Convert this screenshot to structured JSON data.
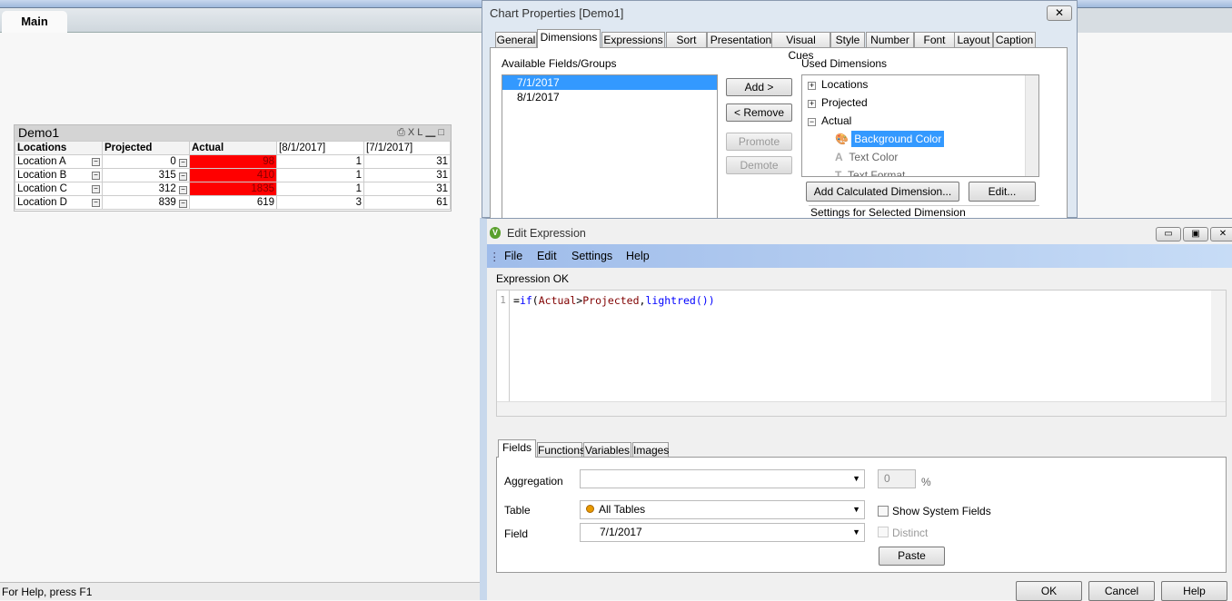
{
  "sheet": {
    "tab": "Main",
    "status": "For Help, press F1"
  },
  "table_object": {
    "title": "Demo1",
    "icons": [
      "print-icon",
      "xl-icon",
      "minimize-icon",
      "maximize-icon"
    ],
    "xl_label": "XL",
    "headers": [
      "Locations",
      "Projected",
      "Actual",
      "[8/1/2017]",
      "[7/1/2017]"
    ],
    "rows": [
      {
        "location": "Location A",
        "projected": "0",
        "actual": "98",
        "aug": "1",
        "jul": "31",
        "highlight": true
      },
      {
        "location": "Location B",
        "projected": "315",
        "actual": "410",
        "aug": "1",
        "jul": "31",
        "highlight": true
      },
      {
        "location": "Location C",
        "projected": "312",
        "actual": "1835",
        "aug": "1",
        "jul": "31",
        "highlight": true
      },
      {
        "location": "Location D",
        "projected": "839",
        "actual": "619",
        "aug": "3",
        "jul": "61",
        "highlight": false
      }
    ],
    "highlight_color": "#ff0000"
  },
  "chart_properties": {
    "title": "Chart Properties [Demo1]",
    "tabs": [
      "General",
      "Dimensions",
      "Expressions",
      "Sort",
      "Presentation",
      "Visual Cues",
      "Style",
      "Number",
      "Font",
      "Layout",
      "Caption"
    ],
    "active_tab": "Dimensions",
    "available_label": "Available Fields/Groups",
    "available": [
      "7/1/2017",
      "8/1/2017"
    ],
    "used_label": "Used Dimensions",
    "used": [
      "Locations",
      "Projected",
      "Actual"
    ],
    "actual_children": [
      "Background Color",
      "Text Color",
      "Text Format"
    ],
    "buttons": {
      "add": "Add >",
      "remove": "< Remove",
      "promote": "Promote",
      "demote": "Demote",
      "add_calc": "Add Calculated Dimension...",
      "edit": "Edit..."
    },
    "settings_label": "Settings for Selected Dimension"
  },
  "edit_expression": {
    "title": "Edit Expression",
    "menu": [
      "File",
      "Edit",
      "Settings",
      "Help"
    ],
    "status": "Expression OK",
    "line_number": "1",
    "code": {
      "p1": "=",
      "p2": "if",
      "p3": "(",
      "p4": "Actual",
      ">": ">",
      "p5": "Projected",
      "p6": ",",
      "p7": "lightred",
      "p8": "())"
    },
    "tabs": [
      "Fields",
      "Functions",
      "Variables",
      "Images"
    ],
    "aggregation_label": "Aggregation",
    "aggregation_value": "",
    "percent_value": "0",
    "percent_sign": "%",
    "table_label": "Table",
    "table_value": "All Tables",
    "field_label": "Field",
    "field_value": "7/1/2017",
    "show_system_fields": "Show System Fields",
    "distinct": "Distinct",
    "paste": "Paste",
    "ok": "OK",
    "cancel": "Cancel",
    "help": "Help"
  }
}
